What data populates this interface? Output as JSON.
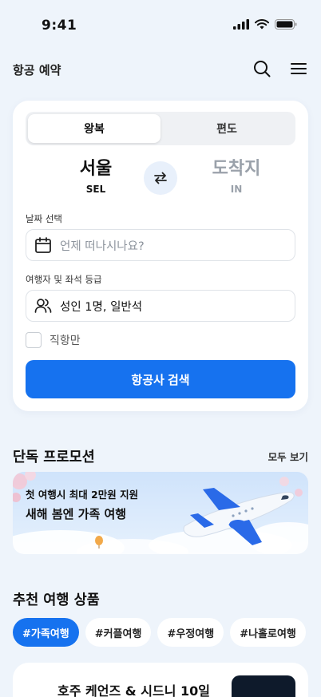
{
  "status_bar": {
    "time": "9:41"
  },
  "header": {
    "title": "항공 예약"
  },
  "search": {
    "tabs": [
      {
        "label": "왕복"
      },
      {
        "label": "편도"
      }
    ],
    "from": {
      "city": "서울",
      "code": "SEL"
    },
    "to": {
      "city": "도착지",
      "code": "IN"
    },
    "date_label": "날짜 선택",
    "date_placeholder": "언제 떠나시나요?",
    "passenger_label": "여행자 및 좌석 등급",
    "passenger_value": "성인 1명, 일반석",
    "direct_only_label": "직항만",
    "search_button": "항공사 검색"
  },
  "promotions": {
    "title": "단독 프로모션",
    "see_all": "모두 보기",
    "banner_sub": "첫 여행시 최대 2만원 지원",
    "banner_title": "새해 봄엔 가족 여행"
  },
  "recommended": {
    "title": "추천 여행 상품",
    "chips": [
      {
        "label": "#가족여행"
      },
      {
        "label": "#커플여행"
      },
      {
        "label": "#우정여행"
      },
      {
        "label": "#나홀로여행"
      }
    ],
    "product_title": "호주 케언즈 & 시드니 10일"
  },
  "colors": {
    "accent": "#1672ef",
    "background": "#eef4fb"
  }
}
